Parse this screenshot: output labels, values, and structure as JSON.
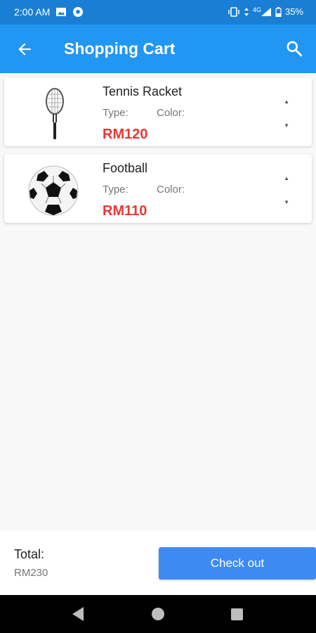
{
  "status_bar": {
    "time": "2:00 AM",
    "network": "4G",
    "battery": "35%"
  },
  "app_bar": {
    "title": "Shopping Cart"
  },
  "cart": {
    "items": [
      {
        "name": "Tennis Racket",
        "type_label": "Type:",
        "color_label": "Color:",
        "price": "RM120",
        "image_icon": "tennis-racket-icon"
      },
      {
        "name": "Football",
        "type_label": "Type:",
        "color_label": "Color:",
        "price": "RM110",
        "image_icon": "football-icon"
      }
    ]
  },
  "summary": {
    "total_label": "Total:",
    "total_value": "RM230",
    "checkout_label": "Check out"
  },
  "colors": {
    "status_bar": "#1a7fd4",
    "app_bar": "#2196f3",
    "price": "#e53935",
    "checkout": "#3d8bf2"
  }
}
